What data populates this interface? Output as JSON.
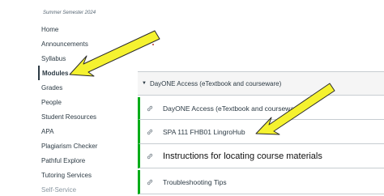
{
  "semester": "Summer Semester 2024",
  "nav": {
    "items": [
      {
        "label": "Home"
      },
      {
        "label": "Announcements"
      },
      {
        "label": "Syllabus"
      },
      {
        "label": "Modules",
        "active": true
      },
      {
        "label": "Grades"
      },
      {
        "label": "People"
      },
      {
        "label": "Student Resources"
      },
      {
        "label": "APA"
      },
      {
        "label": "Plagiarism Checker"
      },
      {
        "label": "Pathful Explore"
      },
      {
        "label": "Tutoring Services"
      },
      {
        "label": "Self-Service"
      }
    ]
  },
  "module": {
    "header": "DayONE Access (eTextbook and courseware)",
    "items": [
      {
        "title": "DayONE Access (eTextbook and courseware)",
        "icon": "link-icon"
      },
      {
        "title": "SPA 111 FHB01 LingroHub",
        "icon": "link-icon"
      },
      {
        "title": "Instructions for locating course materials",
        "icon": "link-icon"
      },
      {
        "title": "Troubleshooting Tips",
        "icon": "link-icon"
      }
    ]
  },
  "colors": {
    "annotation_arrow": "#f5f230",
    "module_item_border": "#00ac18",
    "text": "#2d3b45"
  }
}
